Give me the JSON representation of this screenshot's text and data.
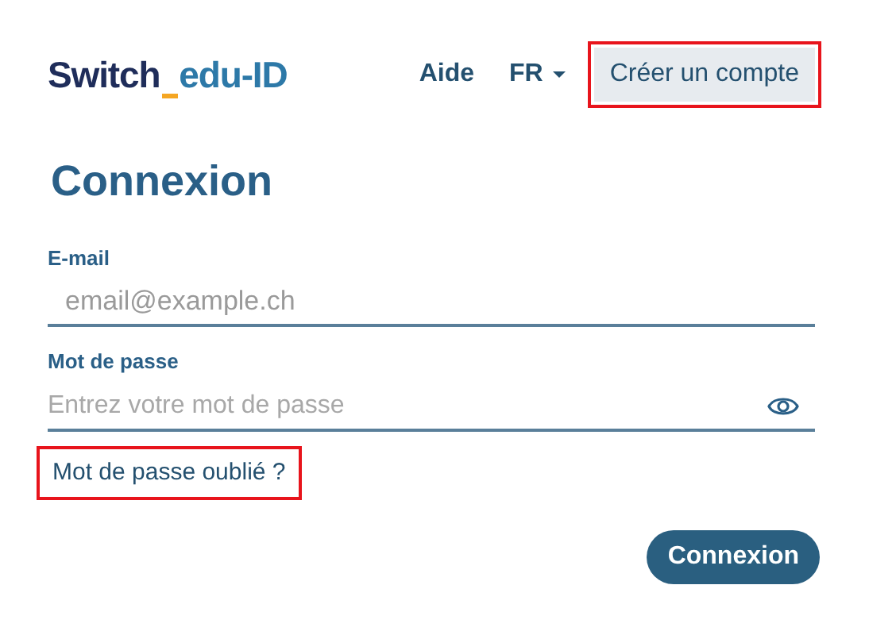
{
  "header": {
    "logo": {
      "part_1": "Switch",
      "part_2": "edu-ID"
    },
    "help_link": "Aide",
    "language": "FR",
    "create_account": {
      "label": "Créer un compte",
      "highlighted": true
    }
  },
  "title": "Connexion",
  "fields": [
    {
      "label": "E-mail",
      "placeholder": "email@example.ch",
      "kind": "email"
    },
    {
      "label": "Mot de passe",
      "placeholder": "Entrez votre mot de passe",
      "kind": "password"
    }
  ],
  "forgot_link": {
    "label": "Mot de passe oublié ?",
    "highlighted": true
  },
  "submit_button": "Connexion"
}
